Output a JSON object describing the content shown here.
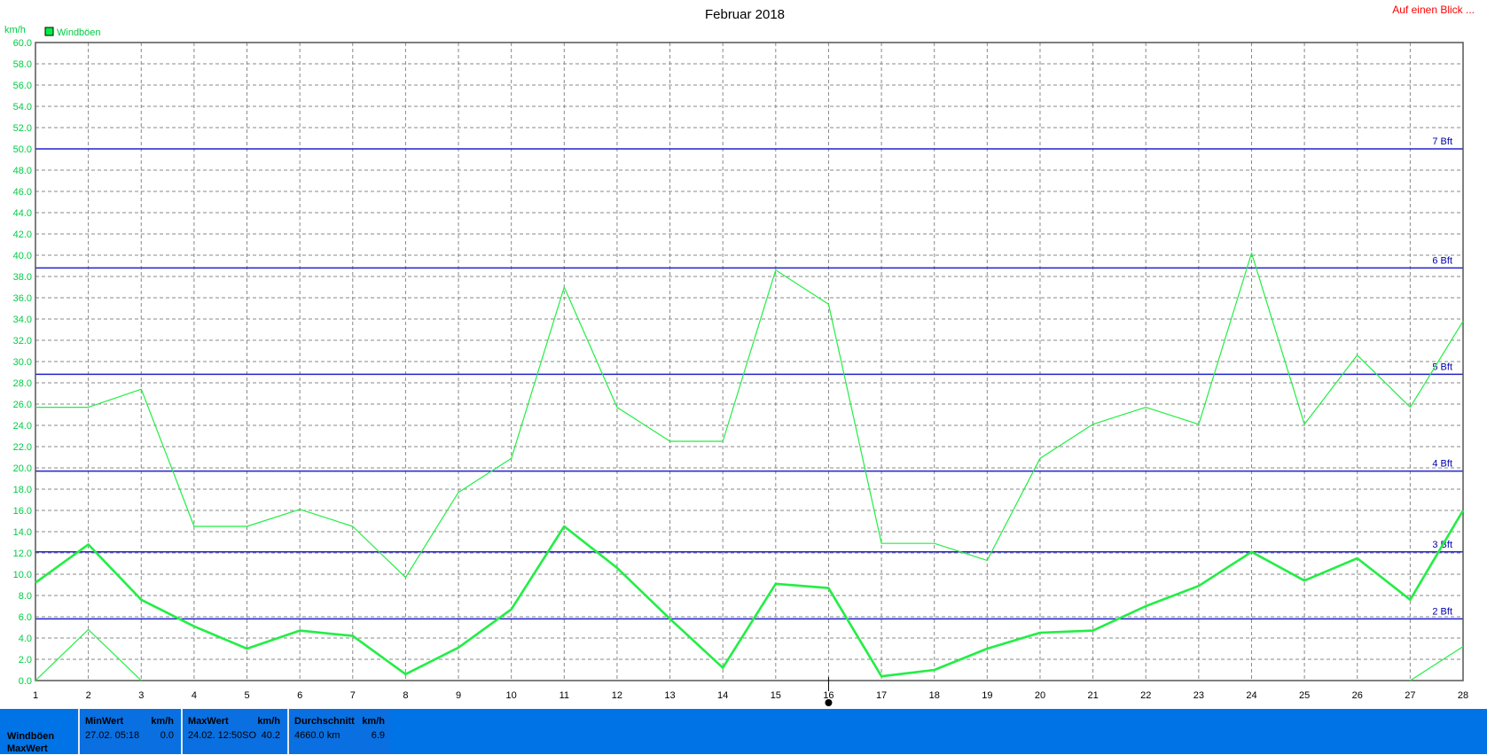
{
  "header": {
    "link": "Auf einen Blick ..."
  },
  "chart_data": {
    "type": "line",
    "title": "Februar 2018",
    "ylabel": "km/h",
    "ylim": [
      0,
      60
    ],
    "ytick_step": 2,
    "x": [
      1,
      2,
      3,
      4,
      5,
      6,
      7,
      8,
      9,
      10,
      11,
      12,
      13,
      14,
      15,
      16,
      17,
      18,
      19,
      20,
      21,
      22,
      23,
      24,
      25,
      26,
      27,
      28
    ],
    "legend": [
      {
        "name": "Windböen",
        "color": "#00ee44"
      }
    ],
    "grid": true,
    "series": [
      {
        "name": "max",
        "color": "#22ee44",
        "values": [
          25.7,
          25.7,
          27.4,
          14.5,
          14.5,
          16.1,
          14.5,
          9.7,
          17.7,
          20.9,
          37.0,
          25.7,
          22.5,
          22.5,
          38.6,
          35.4,
          12.9,
          12.9,
          11.3,
          20.9,
          24.1,
          25.7,
          24.1,
          40.2,
          24.1,
          30.6,
          25.7,
          33.8
        ]
      },
      {
        "name": "avg",
        "color": "#22ee44",
        "values": [
          9.2,
          12.8,
          7.6,
          5.1,
          3.0,
          4.7,
          4.2,
          0.6,
          3.1,
          6.7,
          14.5,
          10.6,
          5.8,
          1.2,
          9.1,
          8.7,
          0.4,
          1.0,
          3.0,
          4.5,
          4.7,
          7.0,
          8.9,
          12.1,
          9.4,
          11.5,
          7.6,
          16.0
        ]
      },
      {
        "name": "min",
        "color": "#22ee44",
        "values": [
          0.0,
          4.8,
          0.0,
          null,
          null,
          null,
          null,
          null,
          null,
          null,
          null,
          null,
          null,
          null,
          null,
          null,
          null,
          null,
          null,
          null,
          null,
          null,
          null,
          null,
          null,
          null,
          0.0,
          3.2
        ]
      }
    ],
    "reference_lines": [
      {
        "label": "2 Bft",
        "value": 5.8
      },
      {
        "label": "3 Bft",
        "value": 12.1
      },
      {
        "label": "4 Bft",
        "value": 19.7
      },
      {
        "label": "5 Bft",
        "value": 28.8
      },
      {
        "label": "6 Bft",
        "value": 38.8
      },
      {
        "label": "7 Bft",
        "value": 50.0
      }
    ],
    "marker_x": 16
  },
  "stats": {
    "row1": "Windböen",
    "row2": "MaxWert",
    "min": {
      "header": "MinWert",
      "unit": "km/h",
      "date": "27.02. 05:18",
      "value": "0.0"
    },
    "max": {
      "header": "MaxWert",
      "unit": "km/h",
      "date": "24.02. 12:50SO",
      "value": "40.2"
    },
    "avg": {
      "header": "Durchschnitt",
      "unit": "km/h",
      "date": "4660.0 km",
      "value": "6.9"
    }
  }
}
